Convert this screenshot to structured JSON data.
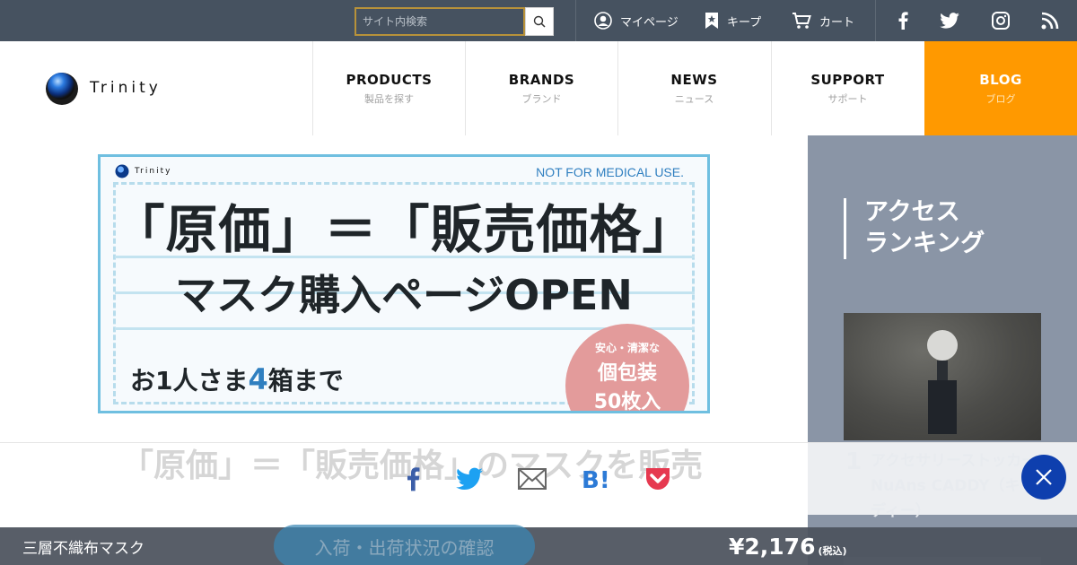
{
  "search": {
    "placeholder": "サイト内検索"
  },
  "utility": {
    "mypage": "マイページ",
    "keep": "キープ",
    "cart": "カート"
  },
  "logo": {
    "text": "Trinity"
  },
  "nav": [
    {
      "en": "PRODUCTS",
      "jp": "製品を探す"
    },
    {
      "en": "BRANDS",
      "jp": "ブランド"
    },
    {
      "en": "NEWS",
      "jp": "ニュース"
    },
    {
      "en": "SUPPORT",
      "jp": "サポート"
    },
    {
      "en": "BLOG",
      "jp": "ブログ"
    }
  ],
  "banner": {
    "logo_text": "Trinity",
    "note": "NOT FOR MEDICAL USE.",
    "headline": "「原価」＝「販売価格」",
    "sub": "マスク購入ページOPEN",
    "limit_pre": "お1人さま",
    "limit_num": "4",
    "limit_post": "箱まで",
    "badge_l1": "安心・清潔な",
    "badge_l2": "個包装",
    "badge_l3": "50枚入"
  },
  "ranking": {
    "title": "アクセス\nランキング",
    "item1_rank": "1",
    "item1_name": "アクセサリーストッカー NuAns CADDY（キャディー）"
  },
  "page": {
    "ghost_title": "「原価」＝「販売価格」のマスクを販売"
  },
  "product_bar": {
    "name": "三層不織布マスク",
    "stock_button": "入荷・出荷状況の確認",
    "price": "¥2,176",
    "tax": "(税込)"
  },
  "colors": {
    "topbar": "#465260",
    "blog_accent": "#ff9900",
    "ranking_bg": "#8a95a6",
    "close_button": "#0e3fae"
  }
}
